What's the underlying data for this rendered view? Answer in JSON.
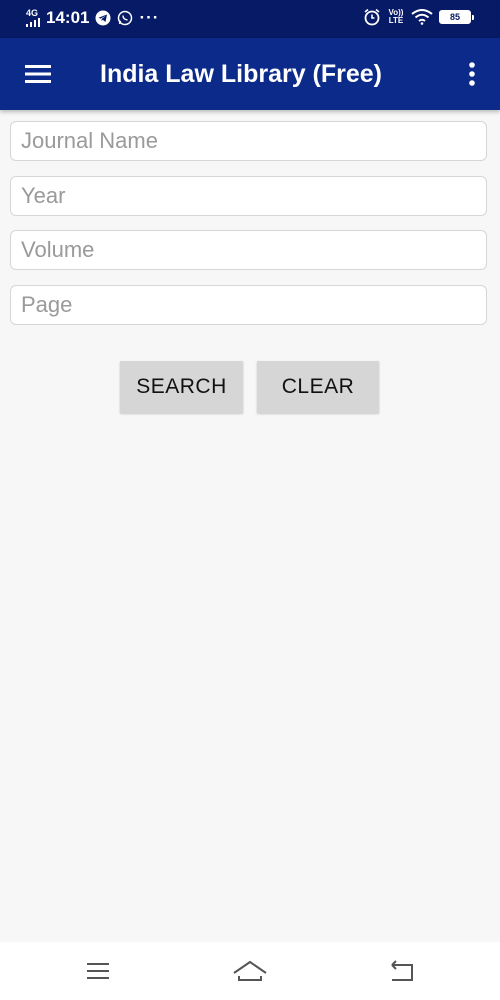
{
  "status_bar": {
    "network": "4G",
    "time": "14:01",
    "dots": "···",
    "volte": "Vo)) LTE",
    "battery": "85"
  },
  "app_bar": {
    "title": "India Law Library (Free)"
  },
  "form": {
    "journal_placeholder": "Journal Name",
    "year_placeholder": "Year",
    "volume_placeholder": "Volume",
    "page_placeholder": "Page",
    "journal_value": "",
    "year_value": "",
    "volume_value": "",
    "page_value": ""
  },
  "buttons": {
    "search_label": "SEARCH",
    "clear_label": "CLEAR"
  },
  "icons": {
    "menu": "hamburger-menu-icon",
    "overflow": "more-vertical-icon",
    "telegram": "telegram-icon",
    "whatsapp": "whatsapp-icon",
    "alarm": "alarm-icon",
    "wifi": "wifi-icon",
    "nav_recents": "recents-icon",
    "nav_home": "home-icon",
    "nav_back": "back-icon"
  },
  "colors": {
    "status_bar": "#061a66",
    "app_bar": "#0b2a8a",
    "background": "#f7f7f7",
    "button": "#d6d6d6"
  }
}
